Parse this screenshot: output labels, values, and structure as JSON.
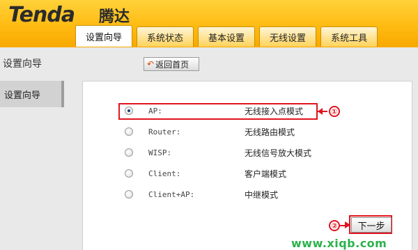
{
  "brand": {
    "logo": "Tenda",
    "logo_cn": "腾达"
  },
  "tabs": [
    {
      "label": "设置向导"
    },
    {
      "label": "系统状态"
    },
    {
      "label": "基本设置"
    },
    {
      "label": "无线设置"
    },
    {
      "label": "系统工具"
    }
  ],
  "page_title": "设置向导",
  "home_button": "返回首页",
  "sidebar": {
    "items": [
      {
        "label": "设置向导"
      }
    ]
  },
  "options": [
    {
      "key": "AP:",
      "label": "无线接入点模式",
      "checked": true
    },
    {
      "key": "Router:",
      "label": "无线路由模式",
      "checked": false
    },
    {
      "key": "WISP:",
      "label": "无线信号放大模式",
      "checked": false
    },
    {
      "key": "Client:",
      "label": "客户端模式",
      "checked": false
    },
    {
      "key": "Client+AP:",
      "label": "中继模式",
      "checked": false
    }
  ],
  "annotations": {
    "marker_1": "①",
    "marker_2": "②"
  },
  "next_button": "下一步",
  "watermark": "www.xiqb.com",
  "colors": {
    "header": "#ffbb12",
    "highlight": "#e0141e",
    "watermark": "#2bb24c"
  }
}
